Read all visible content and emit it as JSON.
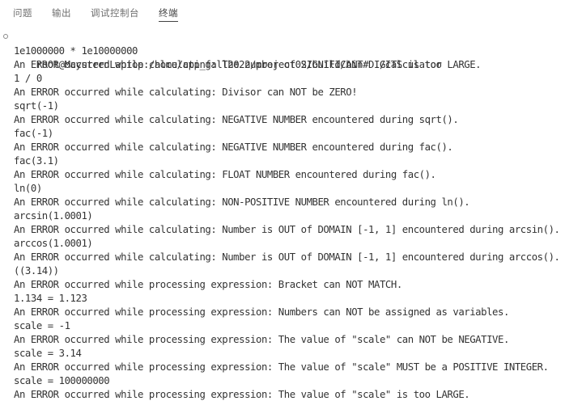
{
  "panel": {
    "tabs": [
      {
        "label": "问题"
      },
      {
        "label": "输出"
      },
      {
        "label": "调试控制台"
      },
      {
        "label": "终端"
      }
    ],
    "active_tab": "终端"
  },
  "terminal": {
    "prompt_indicator_icon": "circle-outline-icon",
    "lines": [
      "root@MaysternLaptop:/home/cpp_fall2022/project02/build/bin# ./calculator",
      "1e1000000 * 1e10000000",
      "An ERROR occurred while calculating: The number of SIGNIFICANT DIGITS is too LARGE.",
      "1 / 0",
      "An ERROR occurred while calculating: Divisor can NOT be ZERO!",
      "sqrt(-1)",
      "An ERROR occurred while calculating: NEGATIVE NUMBER encountered during sqrt().",
      "fac(-1)",
      "An ERROR occurred while calculating: NEGATIVE NUMBER encountered during fac().",
      "fac(3.1)",
      "An ERROR occurred while calculating: FLOAT NUMBER encountered during fac().",
      "ln(0)",
      "An ERROR occurred while calculating: NON-POSITIVE NUMBER encountered during ln().",
      "arcsin(1.0001)",
      "An ERROR occurred while calculating: Number is OUT of DOMAIN [-1, 1] encountered during arcsin().",
      "arccos(1.0001)",
      "An ERROR occurred while calculating: Number is OUT of DOMAIN [-1, 1] encountered during arccos().",
      "((3.14))",
      "An ERROR occurred while processing expression: Bracket can NOT MATCH.",
      "1.134 = 1.123",
      "An ERROR occurred while processing expression: Numbers can NOT be assigned as variables.",
      "scale = -1",
      "An ERROR occurred while processing expression: The value of \"scale\" can NOT be NEGATIVE.",
      "scale = 3.14",
      "An ERROR occurred while processing expression: The value of \"scale\" MUST be a POSITIVE INTEGER.",
      "scale = 100000000",
      "An ERROR occurred while processing expression: The value of \"scale\" is too LARGE."
    ]
  }
}
